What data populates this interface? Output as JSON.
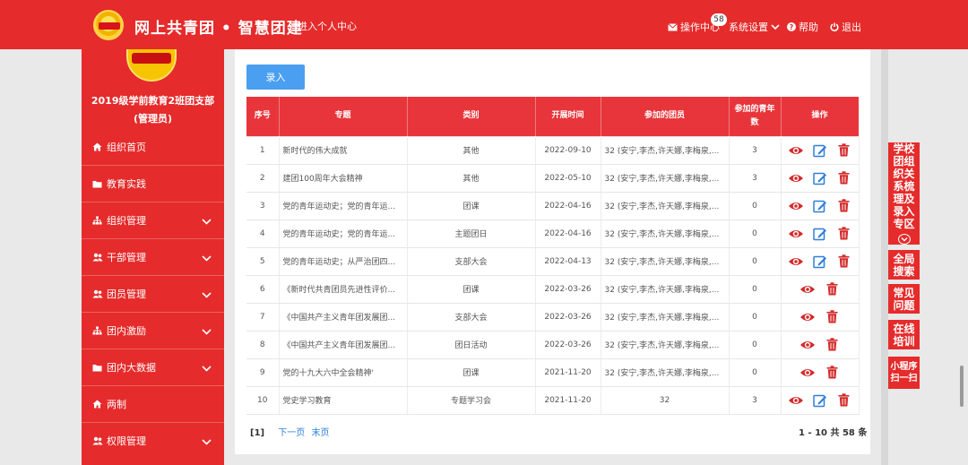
{
  "header": {
    "title": "网上共青团 • 智慧团建",
    "personal_center": "进入个人中心",
    "ops_center": "操作中心",
    "ops_badge": "58",
    "settings": "系统设置",
    "help": "帮助",
    "logout": "退出"
  },
  "sidebar": {
    "org_name_line1": "2019级学前教育2班团支部",
    "org_name_line2": "(管理员)",
    "items": [
      {
        "label": "组织首页",
        "icon": "home-icon",
        "expandable": false
      },
      {
        "label": "教育实践",
        "icon": "folder-icon",
        "expandable": false
      },
      {
        "label": "组织管理",
        "icon": "org-tree-icon",
        "expandable": true
      },
      {
        "label": "干部管理",
        "icon": "users-icon",
        "expandable": true
      },
      {
        "label": "团员管理",
        "icon": "users-icon",
        "expandable": true
      },
      {
        "label": "团内激励",
        "icon": "org-tree-icon",
        "expandable": true
      },
      {
        "label": "团内大数据",
        "icon": "folder-icon",
        "expandable": true
      },
      {
        "label": "两制",
        "icon": "home-icon",
        "expandable": false
      },
      {
        "label": "权限管理",
        "icon": "users-icon",
        "expandable": true
      }
    ]
  },
  "main": {
    "add_button": "录入",
    "columns": [
      "序号",
      "专题",
      "类别",
      "开展时间",
      "参加的团员",
      "参加的青年数",
      "操作"
    ],
    "rows": [
      {
        "no": "1",
        "topic": "新时代的伟大成就",
        "category": "其他",
        "date": "2022-09-10",
        "members": "32 (安宁,李杰,许天娜,李梅泉,...",
        "youth": "3",
        "ops": [
          "view",
          "edit",
          "delete"
        ]
      },
      {
        "no": "2",
        "topic": "建团100周年大会精神",
        "category": "其他",
        "date": "2022-05-10",
        "members": "32 (安宁,李杰,许天娜,李梅泉,...",
        "youth": "3",
        "ops": [
          "view",
          "edit",
          "delete"
        ]
      },
      {
        "no": "3",
        "topic": "党的青年运动史；党的青年运...",
        "category": "团课",
        "date": "2022-04-16",
        "members": "32 (安宁,李杰,许天娜,李梅泉,...",
        "youth": "0",
        "ops": [
          "view",
          "edit",
          "delete"
        ]
      },
      {
        "no": "4",
        "topic": "党的青年运动史；党的青年运...",
        "category": "主题团日",
        "date": "2022-04-16",
        "members": "32 (安宁,李杰,许天娜,李梅泉,...",
        "youth": "0",
        "ops": [
          "view",
          "edit",
          "delete"
        ]
      },
      {
        "no": "5",
        "topic": "党的青年运动史；从严治团四...",
        "category": "支部大会",
        "date": "2022-04-13",
        "members": "32 (安宁,李杰,许天娜,李梅泉,...",
        "youth": "0",
        "ops": [
          "view",
          "edit",
          "delete"
        ]
      },
      {
        "no": "6",
        "topic": "《新时代共青团员先进性评价...",
        "category": "团课",
        "date": "2022-03-26",
        "members": "32 (安宁,李杰,许天娜,李梅泉,...",
        "youth": "0",
        "ops": [
          "view",
          "delete"
        ]
      },
      {
        "no": "7",
        "topic": "《中国共产主义青年团发展团...",
        "category": "支部大会",
        "date": "2022-03-26",
        "members": "32 (安宁,李杰,许天娜,李梅泉,...",
        "youth": "0",
        "ops": [
          "view",
          "delete"
        ]
      },
      {
        "no": "8",
        "topic": "《中国共产主义青年团发展团...",
        "category": "团日活动",
        "date": "2022-03-26",
        "members": "32 (安宁,李杰,许天娜,李梅泉,...",
        "youth": "0",
        "ops": [
          "view",
          "delete"
        ]
      },
      {
        "no": "9",
        "topic": "党的十九大六中全会精神'",
        "category": "团课",
        "date": "2021-11-20",
        "members": "32 (安宁,李杰,许天娜,李梅泉,...",
        "youth": "0",
        "ops": [
          "view",
          "delete"
        ]
      },
      {
        "no": "10",
        "topic": "党史学习教育",
        "category": "专题学习会",
        "date": "2021-11-20",
        "members": "32",
        "youth": "3",
        "ops": [
          "view",
          "edit",
          "delete"
        ]
      }
    ],
    "pager": {
      "current": "[1]",
      "next": "下一页",
      "last": "末页",
      "summary": "1 - 10 共 58 条"
    }
  },
  "right_tools": {
    "org_review": "学校团组织关系梳理及录入专区",
    "search": "全局搜索",
    "faq": "常见问题",
    "training": "在线培训",
    "miniapp": "小程序扫一扫"
  },
  "colors": {
    "brand_red": "#e52b2b",
    "header_cell": "#e8353b",
    "primary_blue": "#4a9ff0",
    "icon_red": "#d42a2a",
    "icon_blue": "#2f7fd8"
  }
}
